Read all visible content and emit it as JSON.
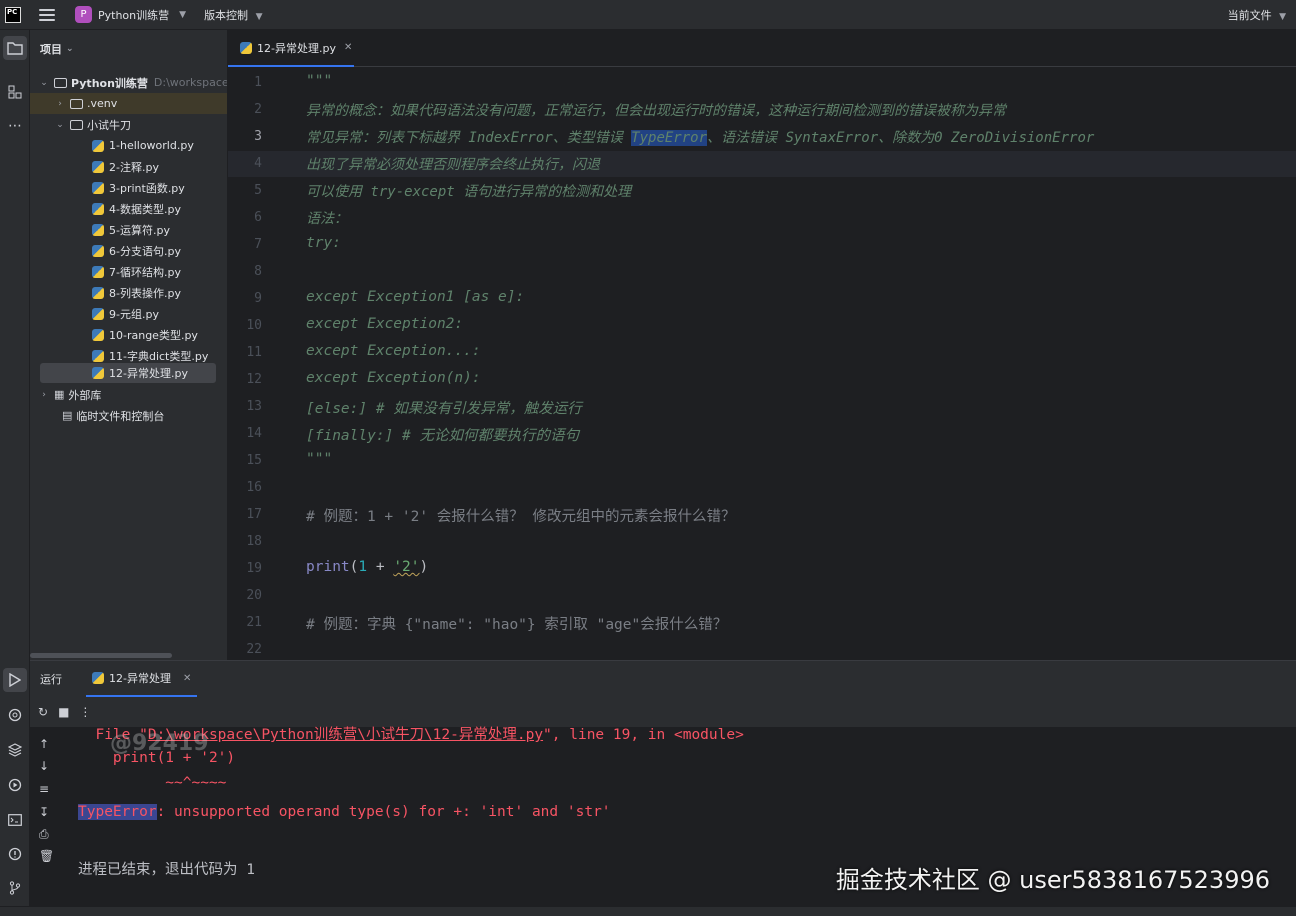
{
  "titlebar": {
    "logo": "PC",
    "project_badge": "P",
    "project_name": "Python训练营",
    "vcs": "版本控制",
    "current_file": "当前文件"
  },
  "project": {
    "header": "项目",
    "root": {
      "label": "Python训练营",
      "path": "D:\\workspace\\P"
    },
    "venv": ".venv",
    "folder": "小试牛刀",
    "files": [
      "1-helloworld.py",
      "2-注释.py",
      "3-print函数.py",
      "4-数据类型.py",
      "5-运算符.py",
      "6-分支语句.py",
      "7-循环结构.py",
      "8-列表操作.py",
      "9-元组.py",
      "10-range类型.py",
      "11-字典dict类型.py",
      "12-异常处理.py"
    ],
    "external_libs": "外部库",
    "scratches": "临时文件和控制台"
  },
  "editor": {
    "tab_label": "12-异常处理.py",
    "line_numbers": [
      "1",
      "2",
      "3",
      "4",
      "5",
      "6",
      "7",
      "8",
      "9",
      "10",
      "11",
      "12",
      "13",
      "14",
      "15",
      "16",
      "17",
      "18",
      "19",
      "20",
      "21",
      "22"
    ],
    "lines": {
      "l1": "\"\"\"",
      "l2": "异常的概念：如果代码语法没有问题，正常运行，但会出现运行时的错误，这种运行期间检测到的错误被称为异常",
      "l3a": "常见异常：列表下标越界 IndexError、类型错误 ",
      "l3sel": "TypeError",
      "l3b": "、语法错误 SyntaxError、除数为0 ZeroDivisionError",
      "l4": "出现了异常必须处理否则程序会终止执行，闪退",
      "l5": "可以使用 try-except 语句进行异常的检测和处理",
      "l6": "语法：",
      "l7": "try:",
      "l9": "except Exception1 [as e]:",
      "l10": "except Exception2:",
      "l11": "except Exception...:",
      "l12": "except Exception(n):",
      "l13": "[else:] # 如果没有引发异常，触发运行",
      "l14": "[finally:] # 无论如何都要执行的语句",
      "l15": "\"\"\"",
      "l17": "# 例题：1 + '2' 会报什么错？ 修改元组中的元素会报什么错？",
      "l19_fn": "print",
      "l19_open": "(",
      "l19_num": "1",
      "l19_op": " + ",
      "l19_str": "'2'",
      "l19_close": ")",
      "l21": "# 例题：字典 {\"name\": \"hao\"} 索引取 \"age\"会报什么错？"
    }
  },
  "run": {
    "label": "运行",
    "tab": "12-异常处理",
    "out_file_prefix": "  File \"",
    "out_file_path": "D:\\workspace\\Python训练营\\小试牛刀\\12-异常处理.py",
    "out_file_suffix": "\", line 19, in <module>",
    "out_code": "    print(1 + '2')",
    "out_caret": "          ~~^~~~~",
    "out_err_name": "TypeError",
    "out_err_msg": ": unsupported operand type(s) for +: 'int' and 'str'",
    "out_exit": "进程已结束，退出代码为 1",
    "overlay_mark": "@92419"
  },
  "watermark": "掘金技术社区 @ user5838167523996",
  "colors": {
    "accent": "#3574f0",
    "error": "#f75464",
    "docstring": "#5f826b"
  }
}
